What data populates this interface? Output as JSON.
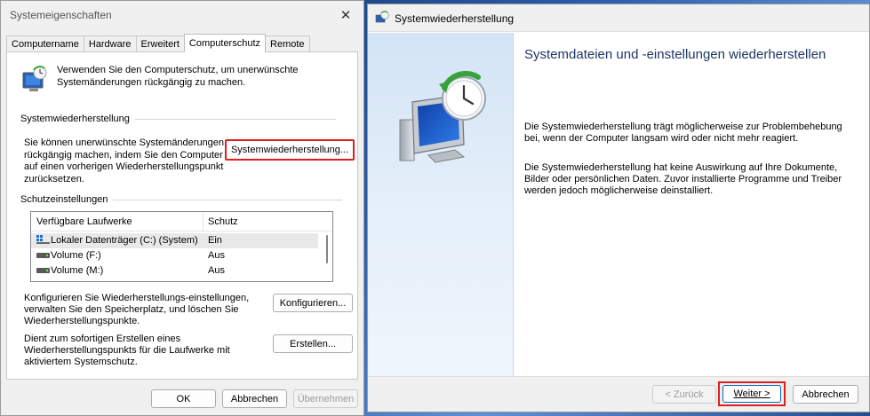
{
  "left_window": {
    "title": "Systemeigenschaften",
    "tabs": [
      "Computername",
      "Hardware",
      "Erweitert",
      "Computerschutz",
      "Remote"
    ],
    "active_tab": "Computerschutz",
    "intro_text": "Verwenden Sie den Computerschutz, um unerwünschte Systemänderungen rückgängig zu machen.",
    "restore_group": {
      "title": "Systemwiederherstellung",
      "text": "Sie können unerwünschte Systemänderungen rückgängig machen, indem Sie den Computer auf einen vorherigen Wiederherstellungspunkt zurücksetzen.",
      "button_label": "Systemwiederherstellung..."
    },
    "protection_group": {
      "title": "Schutzeinstellungen",
      "columns": [
        "Verfügbare Laufwerke",
        "Schutz"
      ],
      "drives": [
        {
          "name": "Lokaler Datenträger (C:) (System)",
          "protection": "Ein",
          "icon": "windows-drive-icon"
        },
        {
          "name": "Volume (F:)",
          "protection": "Aus",
          "icon": "drive-icon"
        },
        {
          "name": "Volume (M:)",
          "protection": "Aus",
          "icon": "drive-icon"
        }
      ],
      "configure_text": "Konfigurieren Sie Wiederherstellungs-einstellungen, verwalten Sie den Speicherplatz, und löschen Sie Wiederherstellungspunkte.",
      "configure_button": "Konfigurieren...",
      "create_text": "Dient zum sofortigen Erstellen eines Wiederherstellungspunkts für die Laufwerke mit aktiviertem Systemschutz.",
      "create_button": "Erstellen..."
    },
    "footer": {
      "ok": "OK",
      "cancel": "Abbrechen",
      "apply": "Übernehmen"
    }
  },
  "right_window": {
    "title": "Systemwiederherstellung",
    "heading": "Systemdateien und -einstellungen wiederherstellen",
    "paragraph1": "Die Systemwiederherstellung trägt möglicherweise zur Problembehebung bei, wenn der Computer langsam wird oder nicht mehr reagiert.",
    "paragraph2": "Die Systemwiederherstellung hat keine Auswirkung auf Ihre Dokumente, Bilder oder persönlichen Daten. Zuvor installierte Programme und Treiber werden jedoch möglicherweise deinstalliert.",
    "footer": {
      "back": "< Zurück",
      "next": "Weiter >",
      "cancel": "Abbrechen"
    }
  },
  "colors": {
    "highlight": "#e01e1e",
    "heading": "#1e3765",
    "side_panel": "#d3e4f5"
  }
}
